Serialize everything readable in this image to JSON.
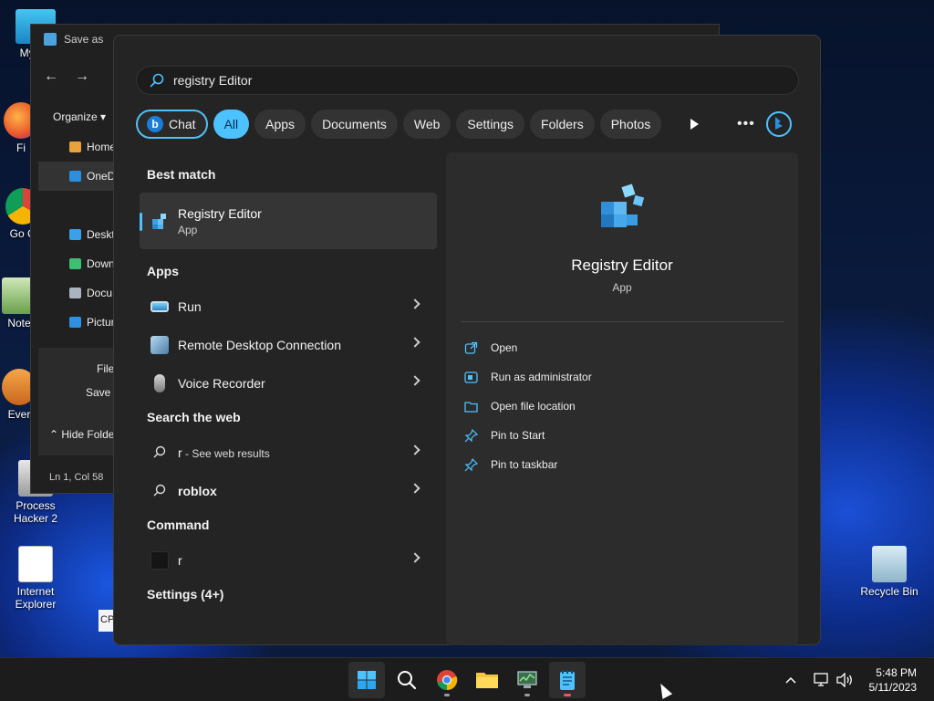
{
  "desktop": {
    "icons": [
      {
        "label": "My Co",
        "icon": "my-computer-icon"
      },
      {
        "label": "Fi",
        "icon": "firefox-icon"
      },
      {
        "label": "Go Ch",
        "icon": "google-chrome-icon"
      },
      {
        "label": "Note",
        "icon": "notepad-icon"
      },
      {
        "label": "Ever",
        "icon": "everything-icon"
      },
      {
        "label": "Process Hacker 2",
        "icon": "process-hacker-icon"
      },
      {
        "label": "Internet Explorer",
        "icon": "internet-explorer-icon"
      },
      {
        "label": "Recycle Bin",
        "icon": "recycle-bin-icon"
      }
    ]
  },
  "background_window": {
    "title": "Save as",
    "organize": "Organize",
    "sidebar": [
      "Home",
      "OneD",
      "Deskt",
      "Down",
      "Docu",
      "Pictur"
    ],
    "file_label": "File",
    "save_as_label": "Save a",
    "hide_folders": "Hide Folde",
    "status": "Ln 1, Col 58",
    "cp_text": "CP"
  },
  "search": {
    "query": "registry Editor",
    "filters": [
      {
        "label": "Chat",
        "active": false
      },
      {
        "label": "All",
        "active": true
      },
      {
        "label": "Apps",
        "active": false
      },
      {
        "label": "Documents",
        "active": false
      },
      {
        "label": "Web",
        "active": false
      },
      {
        "label": "Settings",
        "active": false
      },
      {
        "label": "Folders",
        "active": false
      },
      {
        "label": "Photos",
        "active": false
      }
    ]
  },
  "results": {
    "best_match_title": "Best match",
    "best_match": {
      "name": "Registry Editor",
      "type": "App"
    },
    "apps_title": "Apps",
    "apps": [
      {
        "name": "Run",
        "icon": "run-icon"
      },
      {
        "name": "Remote Desktop Connection",
        "icon": "remote-desktop-icon"
      },
      {
        "name": "Voice Recorder",
        "icon": "voice-recorder-icon"
      }
    ],
    "web_title": "Search the web",
    "web": [
      {
        "query": "r",
        "suffix": " - See web results"
      },
      {
        "query": "roblox",
        "suffix": ""
      }
    ],
    "command_title": "Command",
    "command": {
      "name": "r"
    },
    "settings_title": "Settings (4+)"
  },
  "detail": {
    "name": "Registry Editor",
    "type": "App",
    "actions": [
      {
        "label": "Open",
        "icon": "open-external-icon"
      },
      {
        "label": "Run as administrator",
        "icon": "admin-shield-icon"
      },
      {
        "label": "Open file location",
        "icon": "folder-icon"
      },
      {
        "label": "Pin to Start",
        "icon": "pin-icon"
      },
      {
        "label": "Pin to taskbar",
        "icon": "pin-icon"
      }
    ]
  },
  "taskbar": {
    "apps": [
      {
        "name": "start",
        "icon": "windows-start-icon"
      },
      {
        "name": "search",
        "icon": "search-icon"
      },
      {
        "name": "chrome",
        "icon": "chrome-icon"
      },
      {
        "name": "file-explorer",
        "icon": "folder-icon"
      },
      {
        "name": "task-manager",
        "icon": "monitor-icon"
      },
      {
        "name": "notepad",
        "icon": "notepad-icon"
      }
    ],
    "time": "5:48 PM",
    "date": "5/11/2023"
  },
  "colors": {
    "accent": "#4cc2ff",
    "panel_bg": "#242424",
    "detail_bg": "#2c2c2c",
    "taskbar_bg": "#1c1c1c"
  }
}
